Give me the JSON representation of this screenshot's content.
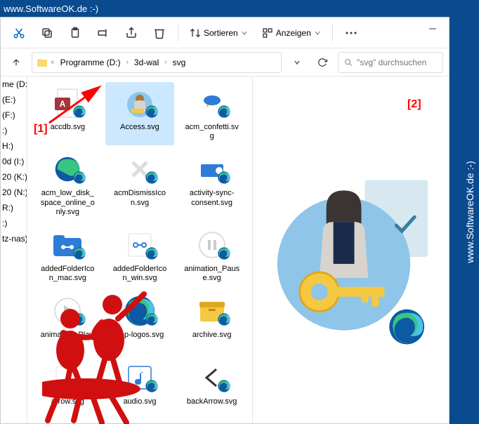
{
  "watermark": "www.SoftwareOK.de :-)",
  "toolbar": {
    "sort": "Sortieren",
    "view": "Anzeigen"
  },
  "breadcrumb": {
    "parts": [
      "Programme (D:)",
      "3d-wal",
      "svg"
    ]
  },
  "search": {
    "placeholder": "\"svg\" durchsuchen"
  },
  "sidebar": {
    "items": [
      "me (D:)",
      "(E:)",
      "(F:)",
      ":)",
      "H:)",
      "0d (I:)",
      "20 (K:)",
      "20 (N:)",
      "R:)",
      ":)",
      "tz-nas)"
    ]
  },
  "files": [
    {
      "label": "accdb.svg",
      "type": "access"
    },
    {
      "label": "Access.svg",
      "type": "person",
      "selected": true
    },
    {
      "label": "acm_confetti.svg",
      "type": "confetti"
    },
    {
      "label": "acm_low_disk_space_online_only.svg",
      "type": "edge"
    },
    {
      "label": "acmDismissIcon.svg",
      "type": "x"
    },
    {
      "label": "activity-sync-consent.svg",
      "type": "sync"
    },
    {
      "label": "addedFolderIcon_mac.svg",
      "type": "folder"
    },
    {
      "label": "addedFolderIcon_win.svg",
      "type": "link"
    },
    {
      "label": "animation_Pause.svg",
      "type": "pause"
    },
    {
      "label": "animation_Play.svg",
      "type": "play"
    },
    {
      "label": "app-logos.svg",
      "type": "edge-big"
    },
    {
      "label": "archive.svg",
      "type": "archive"
    },
    {
      "label": "arrow.svg",
      "type": "arrow"
    },
    {
      "label": "audio.svg",
      "type": "audio"
    },
    {
      "label": "backArrow.svg",
      "type": "back"
    }
  ],
  "annotations": {
    "a1": "[1]",
    "a2": "[2]"
  }
}
